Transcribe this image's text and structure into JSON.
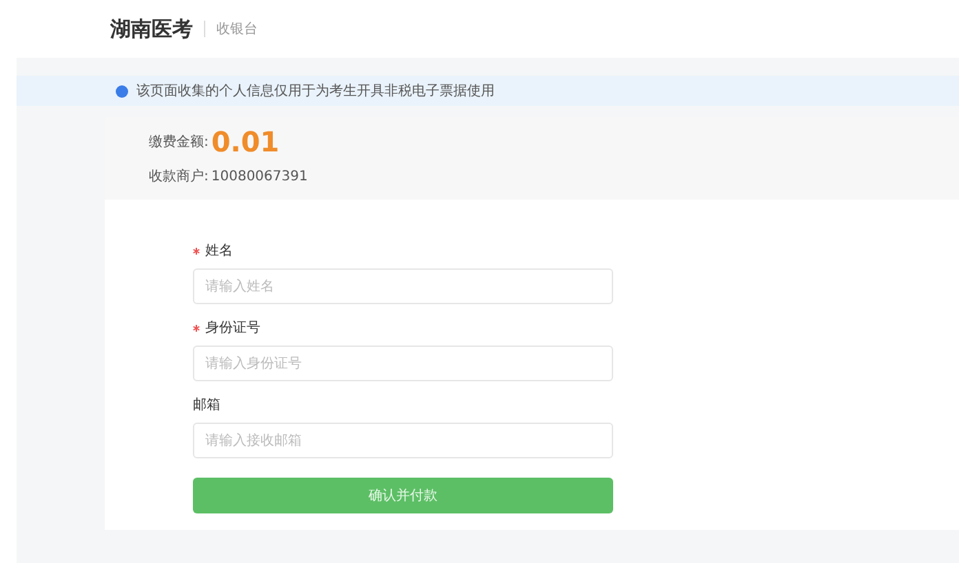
{
  "header": {
    "brand": "湖南医考",
    "subtitle": "收银台"
  },
  "notice": {
    "text": "该页面收集的个人信息仅用于为考生开具非税电子票据使用"
  },
  "payment": {
    "amount_label": "缴费金额:",
    "amount": "0.01",
    "merchant_label": "收款商户:",
    "merchant": "10080067391"
  },
  "fields": [
    {
      "label": "姓名",
      "required": true,
      "placeholder": "请输入姓名"
    },
    {
      "label": "身份证号",
      "required": true,
      "placeholder": "请输入身份证号"
    },
    {
      "label": "邮箱",
      "required": false,
      "placeholder": "请输入接收邮箱"
    }
  ],
  "submit": "确认并付款"
}
